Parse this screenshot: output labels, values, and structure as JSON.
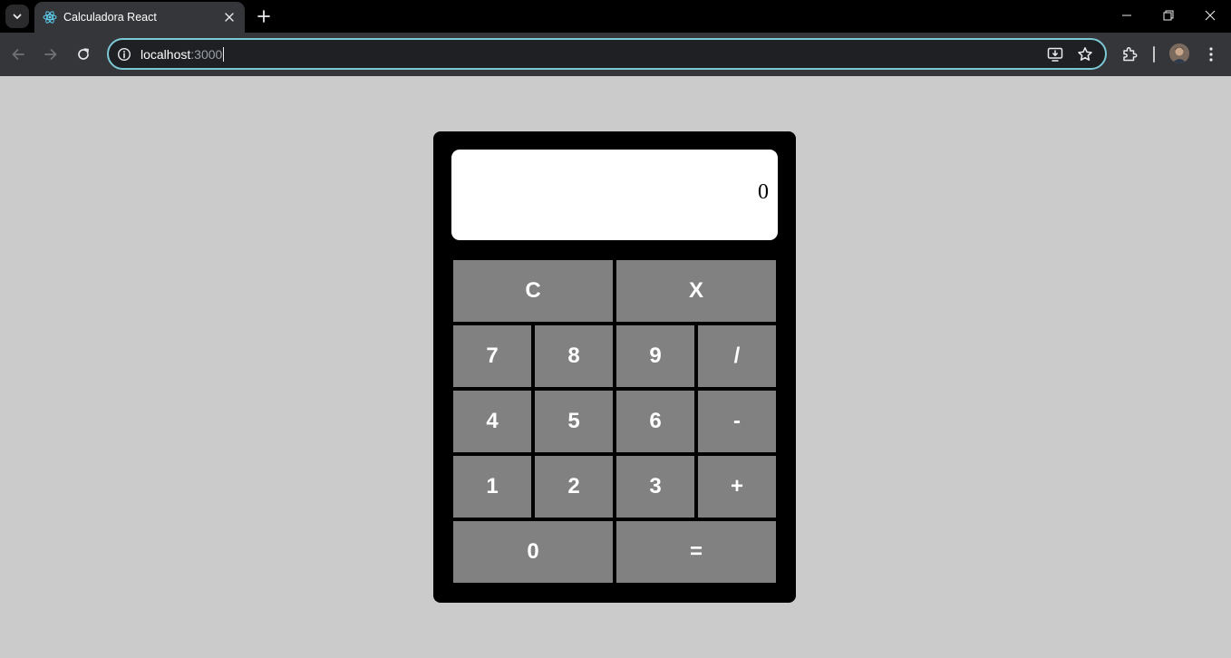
{
  "browser": {
    "tab_title": "Calculadora React",
    "url_host": "localhost",
    "url_port": ":3000"
  },
  "calculator": {
    "display": "0",
    "keys": {
      "clear": "C",
      "backspace": "X",
      "seven": "7",
      "eight": "8",
      "nine": "9",
      "divide": "/",
      "four": "4",
      "five": "5",
      "six": "6",
      "minus": "-",
      "one": "1",
      "two": "2",
      "three": "3",
      "plus": "+",
      "zero": "0",
      "equals": "="
    }
  },
  "colors": {
    "page_background": "#cbcbcb",
    "calculator_body": "#000000",
    "key_background": "#818181",
    "key_text": "#ffffff",
    "display_background": "#ffffff",
    "omnibox_focus_ring": "#7cc9d6"
  },
  "icons": {
    "tab_search": "chevron-down-icon",
    "favicon": "react-logo-icon",
    "tab_close": "close-icon",
    "new_tab": "plus-icon",
    "minimize": "minimize-icon",
    "restore": "restore-icon",
    "window_close": "close-icon",
    "back": "back-arrow-icon",
    "forward": "forward-arrow-icon",
    "reload": "reload-icon",
    "site_info": "info-icon",
    "install": "install-app-icon",
    "bookmark": "star-icon",
    "extensions": "puzzle-icon",
    "profile": "avatar",
    "menu": "more-vert-icon"
  }
}
